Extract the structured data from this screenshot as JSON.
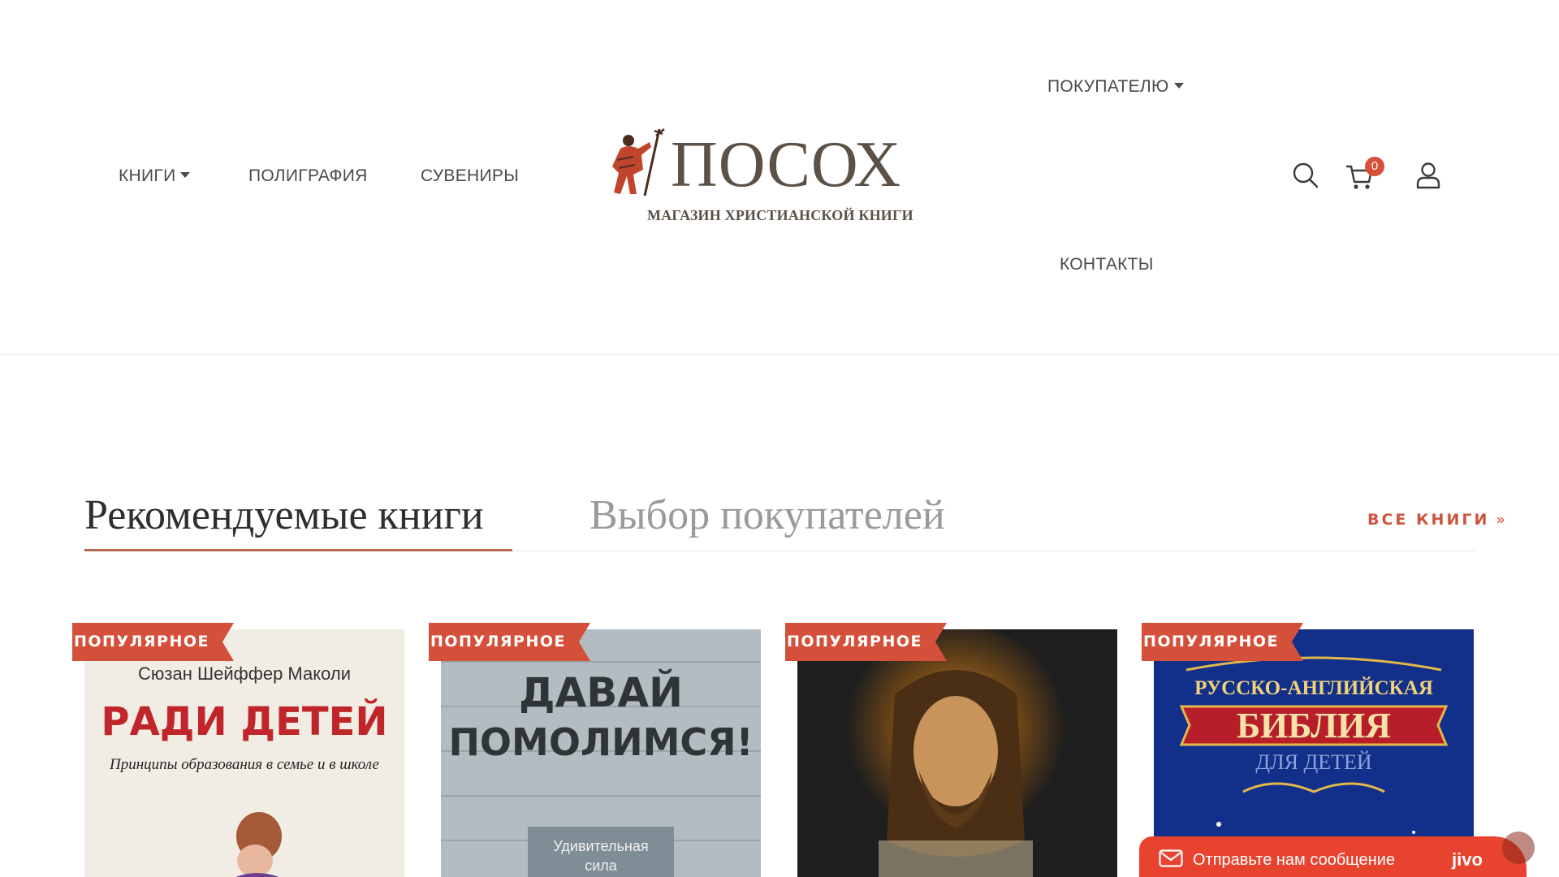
{
  "header": {
    "nav_left": [
      {
        "label": "КНИГИ",
        "has_dropdown": true
      },
      {
        "label": "ПОЛИГРАФИЯ",
        "has_dropdown": false
      },
      {
        "label": "СУВЕНИРЫ",
        "has_dropdown": false
      }
    ],
    "nav_right": [
      {
        "label": "ПОКУПАТЕЛЮ",
        "has_dropdown": true
      },
      {
        "label": "КОНТАКТЫ",
        "has_dropdown": false
      }
    ],
    "logo": {
      "title": "ПОСОХ",
      "subtitle": "МАГАЗИН ХРИСТИАНСКОЙ КНИГИ"
    },
    "icons": {
      "search": "search-icon",
      "cart": "cart-icon",
      "account": "user-icon"
    },
    "cart_count": "0"
  },
  "section": {
    "tabs": [
      {
        "label": "Рекомендуемые книги",
        "active": true
      },
      {
        "label": "Выбор покупателей",
        "active": false
      }
    ],
    "all_books_label": "ВСЕ КНИГИ",
    "all_books_chevron": "»"
  },
  "products": [
    {
      "badge": "ПОПУЛЯРНОЕ",
      "cover_author": "Сюзан Шейффер Маколи",
      "cover_title": "РАДИ ДЕТЕЙ",
      "cover_subtitle": "Принципы образования в семье и в школе"
    },
    {
      "badge": "ПОПУЛЯРНОЕ",
      "cover_title_1": "ДАВАЙ",
      "cover_title_2": "ПОМОЛИМСЯ!",
      "cover_caption_1": "Удивительная",
      "cover_caption_2": "сила"
    },
    {
      "badge": "ПОПУЛЯРНОЕ"
    },
    {
      "badge": "ПОПУЛЯРНОЕ",
      "cover_title_top": "РУССКО-АНГЛИЙСКАЯ",
      "cover_title": "БИБЛИЯ",
      "cover_subtitle": "ДЛЯ ДЕТЕЙ"
    }
  ],
  "chat": {
    "text": "Отправьте нам сообщение",
    "brand": "jivo"
  },
  "colors": {
    "accent": "#d5503a",
    "logo": "#5b5147",
    "tab_underline": "#b56a4c",
    "chat": "#e8432e"
  }
}
